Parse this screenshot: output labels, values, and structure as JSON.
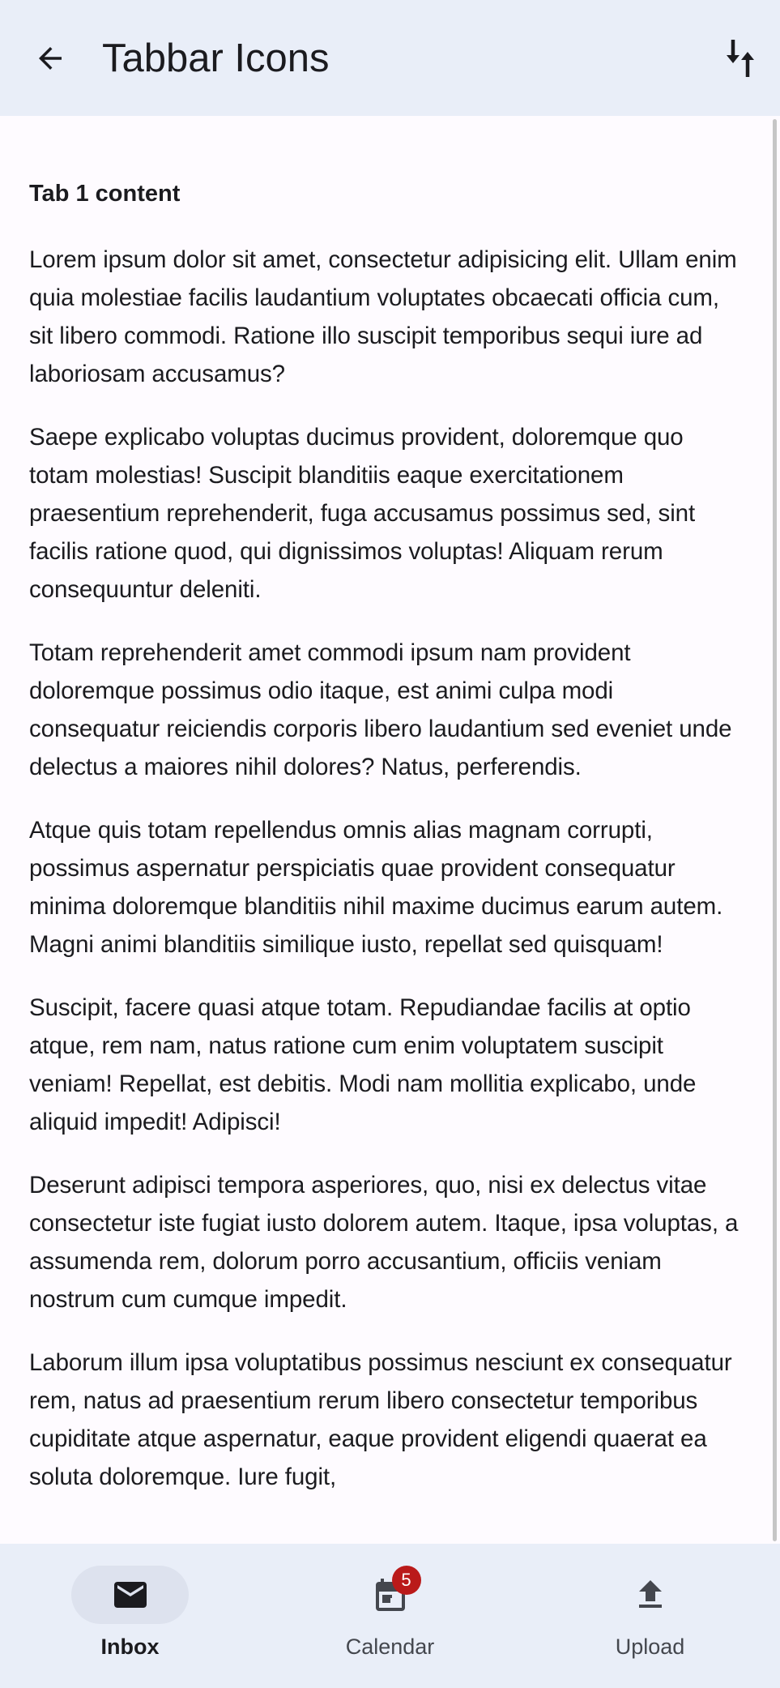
{
  "appbar": {
    "title": "Tabbar Icons",
    "back_icon": "arrow-back-icon",
    "sort_icon": "sort-swap-icon"
  },
  "content": {
    "heading": "Tab 1 content",
    "paragraphs": [
      "Lorem ipsum dolor sit amet, consectetur adipisicing elit. Ullam enim quia molestiae facilis laudantium voluptates obcaecati officia cum, sit libero commodi. Ratione illo suscipit temporibus sequi iure ad laboriosam accusamus?",
      "Saepe explicabo voluptas ducimus provident, doloremque quo totam molestias! Suscipit blanditiis eaque exercitationem praesentium reprehenderit, fuga accusamus possimus sed, sint facilis ratione quod, qui dignissimos voluptas! Aliquam rerum consequuntur deleniti.",
      "Totam reprehenderit amet commodi ipsum nam provident doloremque possimus odio itaque, est animi culpa modi consequatur reiciendis corporis libero laudantium sed eveniet unde delectus a maiores nihil dolores? Natus, perferendis.",
      "Atque quis totam repellendus omnis alias magnam corrupti, possimus aspernatur perspiciatis quae provident consequatur minima doloremque blanditiis nihil maxime ducimus earum autem. Magni animi blanditiis similique iusto, repellat sed quisquam!",
      "Suscipit, facere quasi atque totam. Repudiandae facilis at optio atque, rem nam, natus ratione cum enim voluptatem suscipit veniam! Repellat, est debitis. Modi nam mollitia explicabo, unde aliquid impedit! Adipisci!",
      "Deserunt adipisci tempora asperiores, quo, nisi ex delectus vitae consectetur iste fugiat iusto dolorem autem. Itaque, ipsa voluptas, a assumenda rem, dolorum porro accusantium, officiis veniam nostrum cum cumque impedit.",
      "Laborum illum ipsa voluptatibus possimus nesciunt ex consequatur rem, natus ad praesentium rerum libero consectetur temporibus cupiditate atque aspernatur, eaque provident eligendi quaerat ea soluta doloremque. Iure fugit,"
    ]
  },
  "bottom_nav": {
    "items": [
      {
        "label": "Inbox",
        "icon": "mail-icon",
        "active": true
      },
      {
        "label": "Calendar",
        "icon": "calendar-icon",
        "badge": "5"
      },
      {
        "label": "Upload",
        "icon": "upload-icon"
      }
    ]
  },
  "colors": {
    "surface": "#fefbff",
    "bar_background": "#e9eef8",
    "active_indicator": "#dde2ee",
    "badge": "#ba1a1a"
  }
}
